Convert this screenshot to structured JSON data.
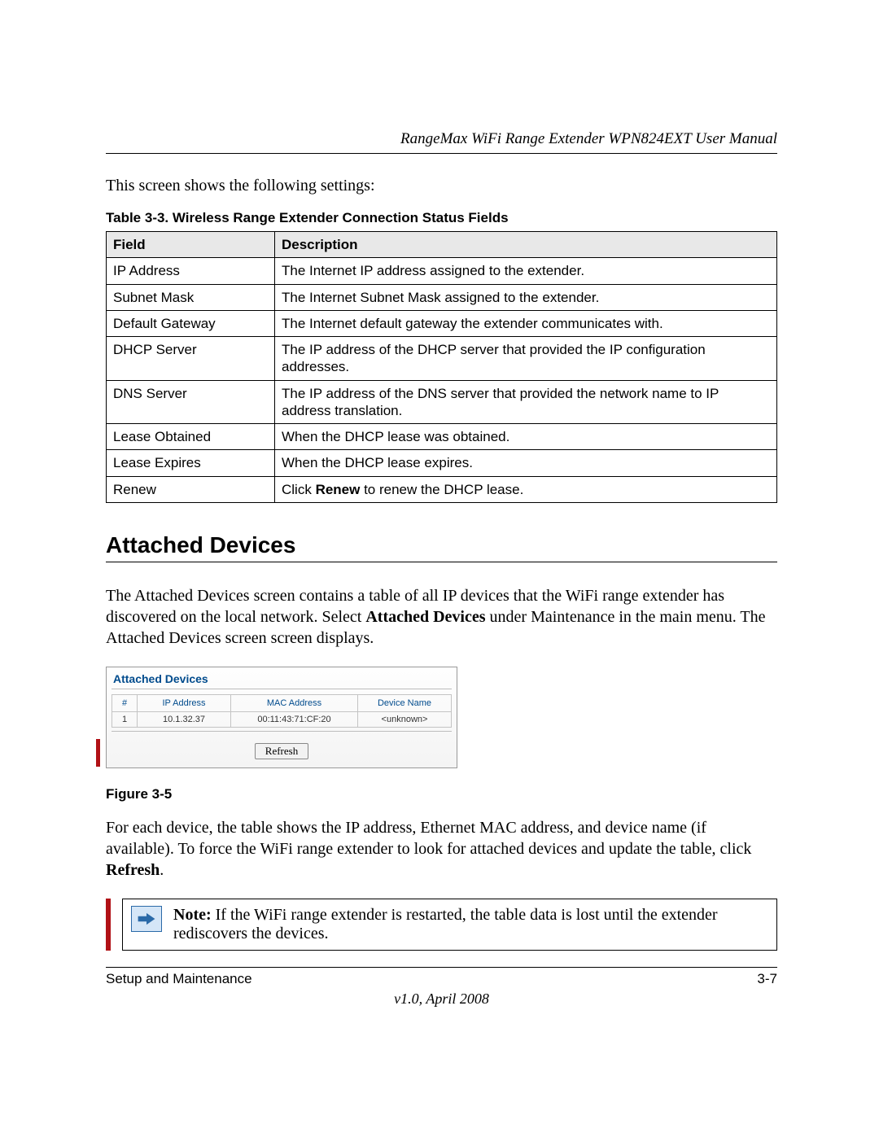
{
  "header": {
    "title": "RangeMax WiFi Range Extender WPN824EXT User Manual"
  },
  "intro": "This screen shows the following settings:",
  "table3": {
    "caption": "Table 3-3.  Wireless Range Extender Connection Status Fields",
    "head_field": "Field",
    "head_desc": "Description",
    "rows": [
      {
        "field": "IP Address",
        "desc": "The Internet IP address assigned to the extender."
      },
      {
        "field": "Subnet Mask",
        "desc": "The Internet Subnet Mask assigned to the extender."
      },
      {
        "field": "Default Gateway",
        "desc": "The Internet default gateway the extender communicates with."
      },
      {
        "field": "DHCP Server",
        "desc": "The IP address of the DHCP server that provided the IP configuration addresses."
      },
      {
        "field": "DNS Server",
        "desc": "The IP address of the DNS server that provided the network name to IP address translation."
      },
      {
        "field": "Lease Obtained",
        "desc": "When the DHCP lease was obtained."
      },
      {
        "field": "Lease Expires",
        "desc": "When the DHCP lease expires."
      },
      {
        "field": "Renew",
        "desc_prefix": "Click ",
        "desc_bold": "Renew",
        "desc_suffix": " to renew the DHCP lease."
      }
    ]
  },
  "section_heading": "Attached Devices",
  "section_body": {
    "p1_a": "The Attached Devices screen contains a table of all IP devices that the WiFi range extender has discovered on the local network. Select ",
    "p1_b": "Attached Devices",
    "p1_c": " under Maintenance in the main menu. The Attached Devices screen screen displays."
  },
  "screenshot": {
    "title": "Attached Devices",
    "headers": {
      "num": "#",
      "ip": "IP Address",
      "mac": "MAC Address",
      "name": "Device Name"
    },
    "row": {
      "num": "1",
      "ip": "10.1.32.37",
      "mac": "00:11:43:71:CF:20",
      "name": "<unknown>"
    },
    "refresh_label": "Refresh"
  },
  "figure_caption": "Figure 3-5",
  "para2": {
    "a": "For each device, the table shows the IP address, Ethernet MAC address, and device name (if available). To force the WiFi range extender to look for attached devices and update the table, click ",
    "b": "Refresh",
    "c": "."
  },
  "note": {
    "label": "Note:",
    "text": " If the WiFi range extender is restarted, the table data is lost until the extender rediscovers the devices."
  },
  "footer": {
    "left": "Setup and Maintenance",
    "right": "3-7",
    "version": "v1.0, April 2008"
  }
}
